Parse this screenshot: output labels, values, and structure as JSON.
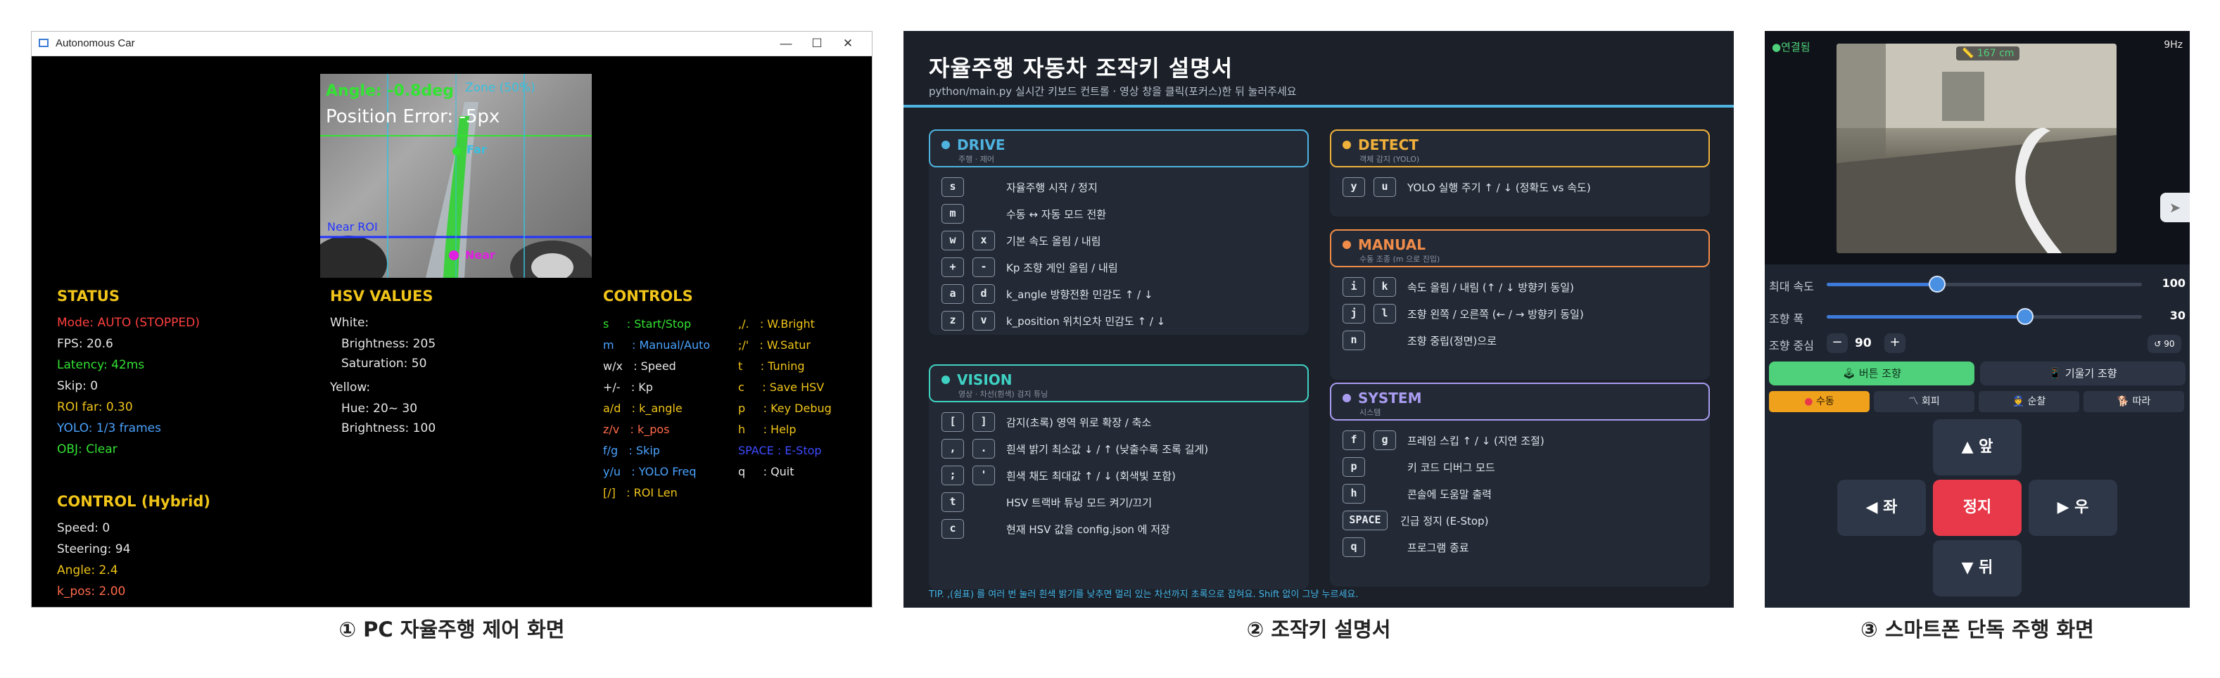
{
  "captions": [
    "① PC 자율주행 제어 화면",
    "② 조작키 설명서",
    "③ 스마트폰 단독 주행 화면"
  ],
  "colors": {
    "hud_green": "#33e233",
    "status_red": "#ff4040",
    "status_blue": "#4aa3ff",
    "accent_yellow": "#f0c419",
    "drive": "#4fb3e0",
    "detect": "#f0b13b",
    "manual": "#f08c4a",
    "vision": "#3fd1c3",
    "system": "#a99cf0",
    "phone_green": "#4ed17a",
    "phone_red": "#e8394a"
  },
  "pc": {
    "window_title": "Autonomous Car",
    "window_controls": [
      "—",
      "☐",
      "✕"
    ],
    "camera": {
      "angle_text": "Angle: -0.8deg",
      "zone_text": "Zone (50%)",
      "position_text": "Position Error: -5px",
      "far_label": "Far",
      "near_roi_label": "Near ROI",
      "near_label": "Near"
    },
    "status": {
      "title": "STATUS",
      "lines": [
        {
          "text": "Mode: AUTO (STOPPED)",
          "color": "#ff4040"
        },
        {
          "text": "FPS: 20.6",
          "color": "#e6e6e6"
        },
        {
          "text": "Latency: 42ms",
          "color": "#33e233"
        },
        {
          "text": "Skip: 0",
          "color": "#e6e6e6"
        },
        {
          "text": "ROI far: 0.30",
          "color": "#f0c419"
        },
        {
          "text": "YOLO: 1/3 frames",
          "color": "#4aa3ff"
        },
        {
          "text": "OBJ: Clear",
          "color": "#33e233"
        }
      ]
    },
    "control": {
      "title": "CONTROL (Hybrid)",
      "lines": [
        {
          "text": "Speed: 0",
          "color": "#e6e6e6"
        },
        {
          "text": "Steering: 94",
          "color": "#e6e6e6"
        },
        {
          "text": "Angle: 2.4",
          "color": "#f0c419"
        },
        {
          "text": "k_pos: 2.00",
          "color": "#ff6a4a"
        }
      ]
    },
    "hsv": {
      "title": "HSV VALUES",
      "white_label": "White:",
      "white_brightness": "Brightness: 205",
      "white_saturation": "Saturation:  50",
      "yellow_label": "Yellow:",
      "yellow_hue": "Hue:  20~ 30",
      "yellow_brightness": "Brightness: 100"
    },
    "controls": {
      "title": "CONTROLS",
      "left": [
        {
          "text": "s     : Start/Stop",
          "color": "#33e233"
        },
        {
          "text": "m     : Manual/Auto",
          "color": "#4aa3ff"
        },
        {
          "text": "w/x   : Speed",
          "color": "#e6e6e6"
        },
        {
          "text": "+/-   : Kp",
          "color": "#e6e6e6"
        },
        {
          "text": "a/d   : k_angle",
          "color": "#f0c419"
        },
        {
          "text": "z/v   : k_pos",
          "color": "#ff6a4a"
        },
        {
          "text": "f/g   : Skip",
          "color": "#4aa3ff"
        },
        {
          "text": "y/u   : YOLO Freq",
          "color": "#4aa3ff"
        },
        {
          "text": "[/]   : ROI Len",
          "color": "#f0c419"
        }
      ],
      "right": [
        {
          "text": ",/.   : W.Bright",
          "color": "#f0c419"
        },
        {
          "text": ";/'   : W.Satur",
          "color": "#f0c419"
        },
        {
          "text": "t     : Tuning",
          "color": "#f0c419"
        },
        {
          "text": "c     : Save HSV",
          "color": "#f0c419"
        },
        {
          "text": "p     : Key Debug",
          "color": "#f0c419"
        },
        {
          "text": "h     : Help",
          "color": "#f0c419"
        },
        {
          "text": "SPACE : E-Stop",
          "color": "#3e4bff"
        },
        {
          "text": "q     : Quit",
          "color": "#e6e6e6"
        }
      ]
    }
  },
  "manual": {
    "title": "자율주행 자동차  조작키 설명서",
    "subtitle": "python/main.py  실시간 키보드 컨트롤  ·  영상 창을 클릭(포커스)한 뒤 눌러주세요",
    "drive": {
      "title": "DRIVE",
      "sub": "주행 · 제어",
      "rows": [
        {
          "keys": [
            "s"
          ],
          "desc": "자율주행 시작 / 정지"
        },
        {
          "keys": [
            "m"
          ],
          "desc": "수동 ↔ 자동 모드 전환"
        },
        {
          "keys": [
            "w",
            "x"
          ],
          "desc": "기본 속도 올림 / 내림"
        },
        {
          "keys": [
            "+",
            "-"
          ],
          "desc": "Kp 조향 게인 올림 / 내림"
        },
        {
          "keys": [
            "a",
            "d"
          ],
          "desc": "k_angle 방향전환 민감도 ↑ / ↓"
        },
        {
          "keys": [
            "z",
            "v"
          ],
          "desc": "k_position 위치오차 민감도 ↑ / ↓"
        }
      ]
    },
    "vision": {
      "title": "VISION",
      "sub": "영상 · 차선(흰색) 검지 튜닝",
      "rows": [
        {
          "keys": [
            "[",
            "]"
          ],
          "desc": "감지(초록) 영역 위로 확장 / 축소"
        },
        {
          "keys": [
            ",",
            "."
          ],
          "desc": "흰색 밝기 최소값 ↓ / ↑  (낮출수록 조록 길게)"
        },
        {
          "keys": [
            ";",
            "'"
          ],
          "desc": "흰색 채도 최대값 ↑ / ↓  (회색빛 포함)"
        },
        {
          "keys": [
            "t"
          ],
          "desc": "HSV 트랙바 튜닝 모드 켜기/끄기"
        },
        {
          "keys": [
            "c"
          ],
          "desc": "현재 HSV 값을 config.json 에 저장"
        }
      ]
    },
    "detect": {
      "title": "DETECT",
      "sub": "객체 감지 (YOLO)",
      "rows": [
        {
          "keys": [
            "y",
            "u"
          ],
          "desc": "YOLO 실행 주기 ↑ / ↓  (정확도 vs 속도)"
        }
      ]
    },
    "manual_sec": {
      "title": "MANUAL",
      "sub": "수동 조종 (m 으로 진입)",
      "rows": [
        {
          "keys": [
            "i",
            "k"
          ],
          "desc": "속도 올림 / 내림   (↑ / ↓ 방향키 동일)"
        },
        {
          "keys": [
            "j",
            "l"
          ],
          "desc": "조향 왼쪽 / 오른쪽  (← / → 방향키 동일)"
        },
        {
          "keys": [
            "n"
          ],
          "desc": "조향 중립(정면)으로"
        }
      ]
    },
    "system": {
      "title": "SYSTEM",
      "sub": "시스템",
      "rows": [
        {
          "keys": [
            "f",
            "g"
          ],
          "desc": "프레임 스킵 ↑ / ↓  (지연 조절)"
        },
        {
          "keys": [
            "p"
          ],
          "desc": "키 코드 디버그 모드"
        },
        {
          "keys": [
            "h"
          ],
          "desc": "콘솔에 도움말 출력"
        },
        {
          "keys": [
            "SPACE"
          ],
          "desc": "긴급 정지 (E-Stop)"
        },
        {
          "keys": [
            "q"
          ],
          "desc": "프로그램 종료"
        }
      ]
    },
    "tip": "TIP.  ,(쉼표) 를 여러 번 눌러 흰색 밝기를 낮추면 멀리 있는 차선까지 초록으로 잡혀요.  Shift 없이 그냥 누르세요."
  },
  "phone": {
    "connection": "●연결됨",
    "distance": "167 cm",
    "rate": "9Hz",
    "sliders": [
      {
        "label": "최대 속도",
        "value": "100",
        "level": 0.35
      },
      {
        "label": "조향 폭",
        "value": "30",
        "level": 0.63
      }
    ],
    "center": {
      "label": "조향 중심",
      "minus": "−",
      "value": "90",
      "plus": "+",
      "reset": "↺ 90"
    },
    "steer_modes": [
      "버튼 조향",
      "기울기 조향"
    ],
    "drive_modes": [
      "수동",
      "회피",
      "순찰",
      "따라"
    ],
    "pad": {
      "up": "▲ 앞",
      "left": "◀ 좌",
      "stop": "정지",
      "right": "▶ 우",
      "down": "▼ 뒤"
    }
  }
}
